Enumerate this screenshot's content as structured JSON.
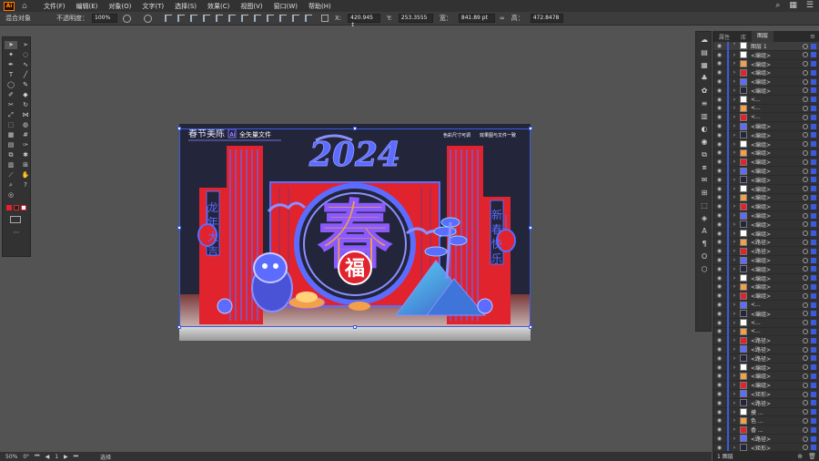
{
  "app": {
    "logo": "Ai"
  },
  "menu": [
    "文件(F)",
    "编辑(E)",
    "对象(O)",
    "文字(T)",
    "选择(S)",
    "效果(C)",
    "视图(V)",
    "窗口(W)",
    "帮助(H)"
  ],
  "control": {
    "selection_label": "混合对象",
    "opacity_label": "不透明度：",
    "opacity_value": "100%",
    "x_label": "X:",
    "x_value": "420.945 ↕",
    "y_label": "Y:",
    "y_value": "253.3555",
    "w_label": "宽：",
    "w_value": "841.89 pt",
    "h_label": "高：",
    "h_value": "472.8478"
  },
  "artboard": {
    "brand": "春节美陈",
    "badge_ai": "Ai",
    "badge_text": "全矢量文件",
    "note_left": "色彩尺寸可调",
    "note_right": "效果图与文件一致",
    "year": "2024",
    "center_char": "春",
    "fu_char": "福",
    "left_banner": [
      "龙",
      "年",
      "大",
      "吉"
    ],
    "right_banner": [
      "新",
      "春",
      "快",
      "乐"
    ]
  },
  "colors": {
    "red": "#e1232e",
    "blue": "#5b6cff",
    "gold": "#f2a04a",
    "navy": "#23253b",
    "accent": "#3b5bdc"
  },
  "layers": {
    "tabs": [
      "属性",
      "库",
      "图层"
    ],
    "active_tab": "图层",
    "top_layer": "图层 1",
    "rows": [
      "<编组>",
      "<编组>",
      "<编组>",
      "<编组>",
      "<编组>",
      "<...",
      "<...",
      "<...",
      "<编组>",
      "<编组>",
      "<编组>",
      "<编组>",
      "<编组>",
      "<编组>",
      "<编组>",
      "<编组>",
      "<编组>",
      "<编组>",
      "<编组>",
      "<编组>",
      "<编组>",
      "<路径>",
      "<路径>",
      "<编组>",
      "<编组>",
      "<编组>",
      "<编组>",
      "<编组>",
      "<...",
      "<编组>",
      "<...",
      "<...",
      "<路径>",
      "<路径>",
      "<路径>",
      "<编组>",
      "<编组>",
      "<编组>",
      "<矩形>",
      "<路径>",
      "摸 ...",
      "色 ...",
      "香 ...",
      "<路径>",
      "<矩形>",
      "<编组>"
    ],
    "footer_label": "1 图层"
  },
  "status": {
    "zoom": "50%",
    "rotation": "0°",
    "page": "1",
    "mode": "选择"
  }
}
